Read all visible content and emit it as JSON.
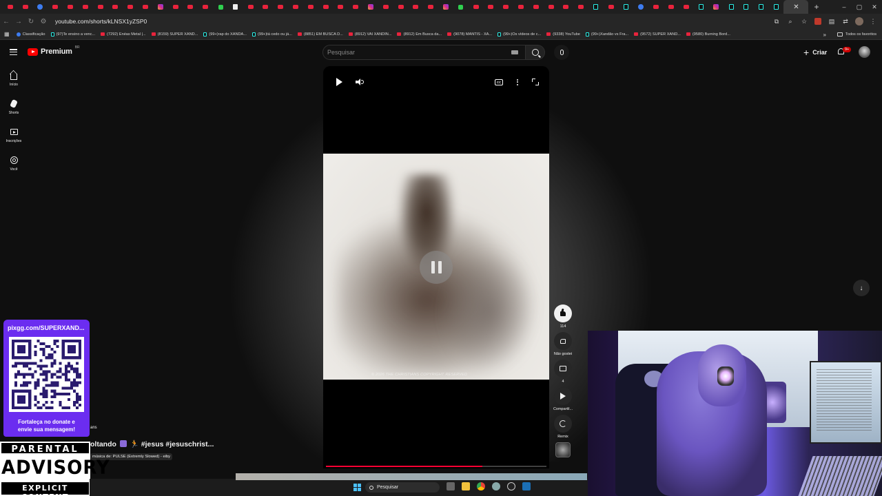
{
  "browser": {
    "tabs": [
      "yt",
      "yt",
      "ext-b",
      "yt",
      "yt",
      "yt",
      "yt",
      "yt",
      "yt",
      "yt",
      "ig",
      "yt",
      "yt",
      "yt",
      "grn",
      "wht",
      "yt",
      "yt",
      "yt",
      "yt",
      "yt",
      "yt",
      "yt",
      "yt",
      "ig",
      "yt",
      "yt",
      "yt",
      "yt",
      "ig",
      "grn",
      "yt",
      "yt",
      "yt",
      "yt",
      "yt",
      "yt",
      "yt",
      "yt",
      "tt",
      "yt",
      "tt",
      "blue",
      "yt",
      "yt",
      "yt",
      "tt",
      "ig",
      "tt",
      "tt",
      "tt",
      "tt"
    ],
    "active_tab_close": "✕",
    "new_tab": "+",
    "window_controls": [
      "–",
      "▢",
      "✕"
    ],
    "url": "youtube.com/shorts/kLNSX1yZSP0",
    "bookmarks": [
      {
        "label": "Classificação",
        "icon": "blue"
      },
      {
        "label": "(97)Te ensino a venc...",
        "icon": "tt"
      },
      {
        "label": "(7292) Enéas Metal |...",
        "icon": "yt"
      },
      {
        "label": "(8159) SUPER XAND...",
        "icon": "yt"
      },
      {
        "label": "(99+)rap do XANDÃ...",
        "icon": "tt"
      },
      {
        "label": "(99+)tá cedo ou já...",
        "icon": "tt"
      },
      {
        "label": "(8851) EM BUSCA D...",
        "icon": "yt"
      },
      {
        "label": "(8912) VAI XANDIN...",
        "icon": "yt"
      },
      {
        "label": "(8912) Em Busca da...",
        "icon": "yt"
      },
      {
        "label": "(9078) MANTIS - XA...",
        "icon": "yt"
      },
      {
        "label": "(99+)Os vídeos de c...",
        "icon": "tt"
      },
      {
        "label": "(9338) YouTube",
        "icon": "yt"
      },
      {
        "label": "(99+)Xandão vs Fra...",
        "icon": "tt"
      },
      {
        "label": "(9572) SUPER XAND...",
        "icon": "yt"
      },
      {
        "label": "(9580) Burning Bord...",
        "icon": "yt"
      }
    ],
    "bookmarks_more": "»",
    "all_bookmarks": "Todos os favoritos"
  },
  "youtube": {
    "logo_text": "Premium",
    "region": "BR",
    "search_placeholder": "Pesquisar",
    "create_label": "Criar",
    "notifications_badge": "9+",
    "rail": [
      {
        "label": "Início",
        "icon": "home-icon"
      },
      {
        "label": "Shorts",
        "icon": "shorts-icon"
      },
      {
        "label": "Inscrições",
        "icon": "subscriptions-icon"
      },
      {
        "label": "Você",
        "icon": "you-icon"
      }
    ],
    "player": {
      "cc_label": "CC",
      "copyright": "© 2026 THE CHRISTIANS COPYRIGHT RESERVED",
      "progress": 0.71
    },
    "actions": {
      "likes": "114",
      "dislike_label": "Não gostei",
      "comments": "4",
      "share_label": "Compartil...",
      "remix_label": "Remix"
    },
    "overlay": {
      "channel_suffix": "ans",
      "title": "oltando",
      "title_rest": "🏃 #jesus #jesuschrist...",
      "music": "música de: PULSE (Extremly Slowed) - eiby"
    }
  },
  "donation": {
    "url": "pixgg.com/SUPERXAND...",
    "message_line1": "Fortaleça no donate e",
    "message_line2": "envie sua mensagem!"
  },
  "advisory": {
    "line1": "PARENTAL",
    "line2": "ADVISORY",
    "line3": "EXPLICIT CONTENT"
  },
  "taskbar": {
    "search_label": "Pesquisar"
  },
  "colors": {
    "youtube_red": "#ff0000",
    "progress_red": "#ff0033",
    "donate_purple": "#6b2df0",
    "background": "#0f0f0f"
  }
}
